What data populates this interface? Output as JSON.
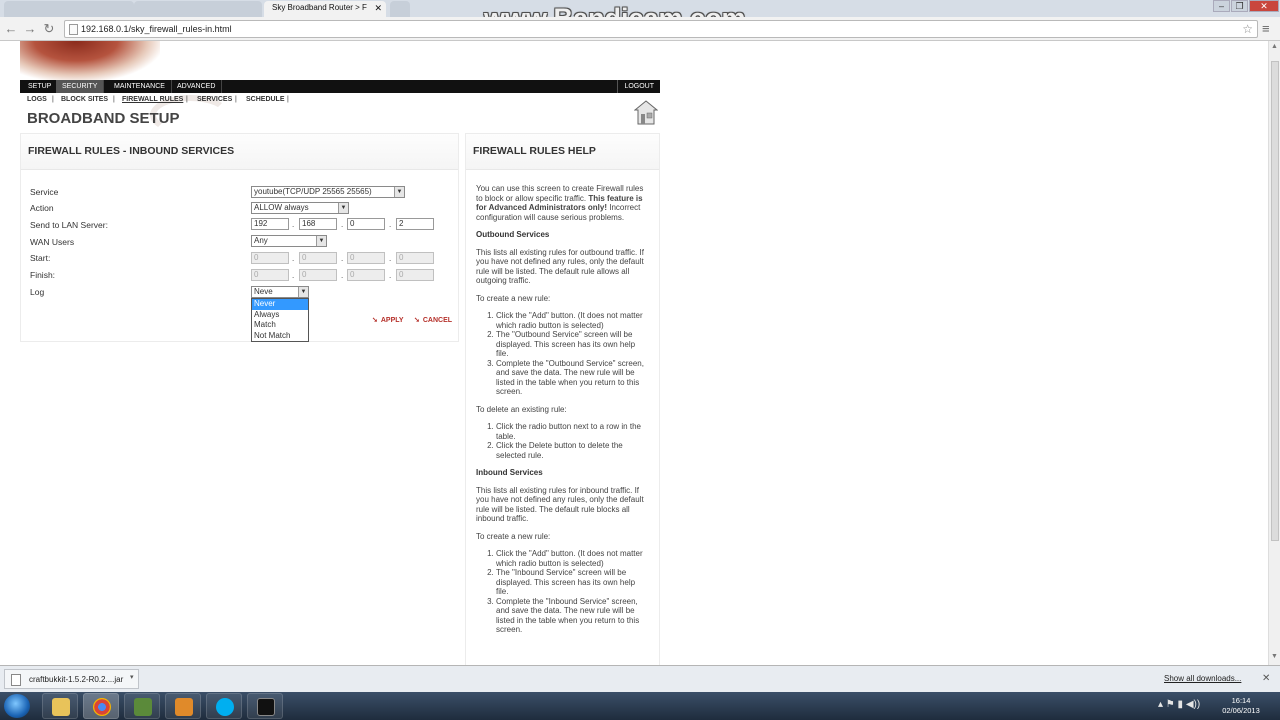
{
  "browser": {
    "tabs": [
      {
        "label": ""
      },
      {
        "label": ""
      },
      {
        "label": "Sky Broadband Router > F"
      }
    ],
    "url": "192.168.0.1/sky_firewall_rules-in.html",
    "watermark": "www.Bandicam.com"
  },
  "router": {
    "menu": [
      "SETUP",
      "SECURITY",
      "MAINTENANCE",
      "ADVANCED"
    ],
    "logout": "LOGOUT",
    "submenu": [
      "LOGS",
      "BLOCK SITES",
      "FIREWALL RULES",
      "SERVICES",
      "SCHEDULE"
    ],
    "page_title": "BROADBAND SETUP"
  },
  "form": {
    "title": "FIREWALL RULES - INBOUND SERVICES",
    "labels": {
      "service": "Service",
      "action": "Action",
      "lan": "Send to LAN Server:",
      "wan": "WAN Users",
      "start": "Start:",
      "finish": "Finish:",
      "log": "Log"
    },
    "service_value": "youtube(TCP/UDP 25565 25565)",
    "action_value": "ALLOW always",
    "lan_ip": [
      "192",
      "168",
      "0",
      "2"
    ],
    "wan_value": "Any",
    "start_ip": [
      "0",
      "0",
      "0",
      "0"
    ],
    "finish_ip": [
      "0",
      "0",
      "0",
      "0"
    ],
    "log_value": "Neve",
    "log_options": [
      "Never",
      "Always",
      "Match",
      "Not Match"
    ],
    "apply": "APPLY",
    "cancel": "CANCEL"
  },
  "help": {
    "title": "FIREWALL RULES HELP",
    "intro": "You can use this screen to create Firewall rules to block or allow specific traffic.",
    "intro_bold": "This feature is for Advanced Administrators only!",
    "intro_tail": "Incorrect configuration will cause serious problems.",
    "outbound_heading": "Outbound Services",
    "outbound_text": "This lists all existing rules for outbound traffic. If you have not defined any rules, only the default rule will be listed. The default rule allows all outgoing traffic.",
    "create_heading": "To create a new rule:",
    "outbound_steps": [
      "Click the \"Add\" button. (It does not matter which radio button is selected)",
      "The \"Outbound Service\" screen will be displayed. This screen has its own help file.",
      "Complete the \"Outbound Service\" screen, and save the data. The new rule will be listed in the table when you return to this screen."
    ],
    "delete_heading": "To delete an existing rule:",
    "delete_steps": [
      "Click the radio button next to a row in the table.",
      "Click the Delete button to delete the selected rule."
    ],
    "inbound_heading": "Inbound Services",
    "inbound_text": "This lists all existing rules for inbound traffic. If you have not defined any rules, only the default rule will be listed. The default rule blocks all inbound traffic.",
    "create_heading2": "To create a new rule:",
    "inbound_steps": [
      "Click the \"Add\" button. (It does not matter which radio button is selected)",
      "The \"Inbound Service\" screen will be displayed. This screen has its own help file.",
      "Complete the \"Inbound Service\" screen, and save the data. The new rule will be listed in the table when you return to this screen."
    ]
  },
  "downloads": {
    "file": "craftbukkit-1.5.2-R0.2....jar",
    "show_all": "Show all downloads..."
  },
  "taskbar": {
    "time": "16:14",
    "date": "02/06/2013"
  }
}
